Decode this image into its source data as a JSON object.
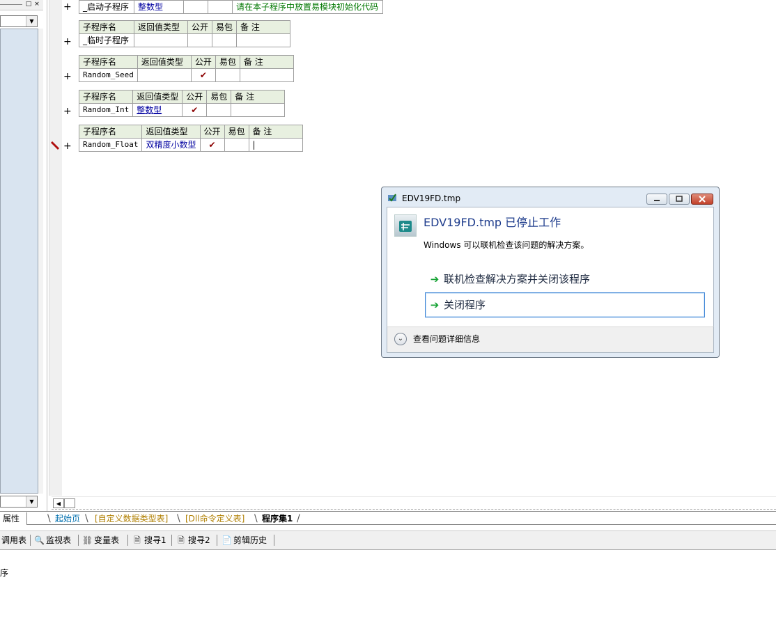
{
  "left_panel": {
    "pin_icon": "□",
    "close_icon": "×",
    "combo_arrow": "▼"
  },
  "tables": [
    {
      "row_name": "_启动子程序",
      "row_type": "整数型",
      "row_public": "",
      "row_pkg": "",
      "row_note": "请在本子程序中放置易模块初始化代码"
    },
    {
      "headers": [
        "子程序名",
        "返回值类型",
        "公开",
        "易包",
        "备 注"
      ],
      "row_name": "_临时子程序",
      "row_type": "",
      "row_public": "",
      "row_pkg": "",
      "row_note": ""
    },
    {
      "headers": [
        "子程序名",
        "返回值类型",
        "公开",
        "易包",
        "备 注"
      ],
      "row_name": "Random_Seed",
      "row_type": "",
      "row_public": "✔",
      "row_pkg": "",
      "row_note": ""
    },
    {
      "headers": [
        "子程序名",
        "返回值类型",
        "公开",
        "易包",
        "备 注"
      ],
      "row_name": "Random_Int",
      "row_type": "整数型",
      "row_public": "✔",
      "row_pkg": "",
      "row_note": ""
    },
    {
      "headers": [
        "子程序名",
        "返回值类型",
        "公开",
        "易包",
        "备 注"
      ],
      "row_name": "Random_Float",
      "row_type": "双精度小数型",
      "row_public": "✔",
      "row_pkg": "",
      "row_note": "|"
    }
  ],
  "plus_sign": "+",
  "tabs": {
    "properties": "属性",
    "start_page": "起始页",
    "custom_types": "[自定义数据类型表]",
    "dll_table": "[Dll命令定义表]",
    "program_set": "程序集1"
  },
  "toolbar": [
    {
      "label": "调用表",
      "icon": ""
    },
    {
      "label": "监视表",
      "icon": "🔍"
    },
    {
      "label": "变量表",
      "icon": "⛓"
    },
    {
      "label": "搜寻1",
      "icon": "🗎"
    },
    {
      "label": "搜寻2",
      "icon": "🗎"
    },
    {
      "label": "剪辑历史",
      "icon": "📄"
    }
  ],
  "output": {
    "text": "序"
  },
  "dialog": {
    "title": "EDV19FD.tmp",
    "heading": "EDV19FD.tmp 已停止工作",
    "description": "Windows 可以联机检查该问题的解决方案。",
    "option_online": "联机检查解决方案并关闭该程序",
    "option_close": "关闭程序",
    "details": "查看问题详细信息",
    "arrow_glyph": "➔",
    "expand_glyph": "⌄"
  }
}
